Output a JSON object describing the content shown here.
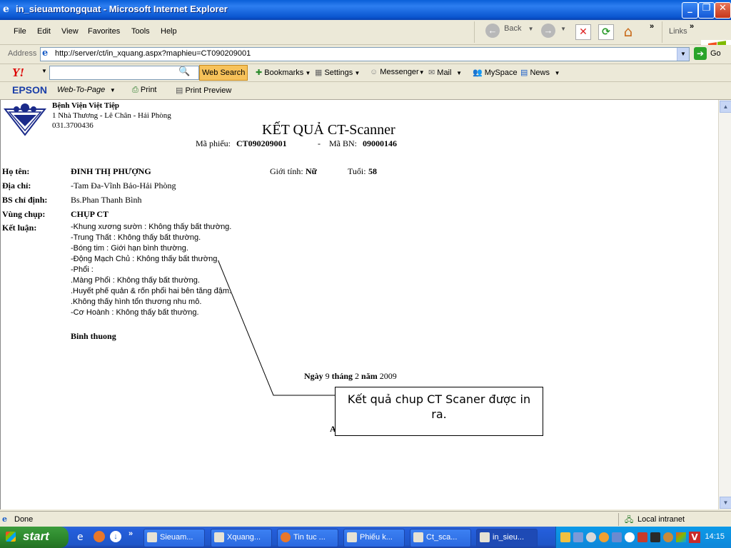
{
  "window": {
    "title": "in_sieuamtongquat - Microsoft Internet Explorer"
  },
  "menu": [
    "File",
    "Edit",
    "View",
    "Favorites",
    "Tools",
    "Help"
  ],
  "toolbar": {
    "back": "Back",
    "links": "Links"
  },
  "address": {
    "label": "Address",
    "url": "http://server/ct/in_xquang.aspx?maphieu=CT090209001",
    "go": "Go"
  },
  "yahoo": {
    "search_button": "Web Search",
    "bookmarks": "Bookmarks",
    "settings": "Settings",
    "messenger": "Messenger",
    "mail": "Mail",
    "myspace": "MySpace",
    "news": "News"
  },
  "epson": {
    "brand": "EPSON",
    "web_to_page": "Web-To-Page",
    "print": "Print",
    "print_preview": "Print Preview"
  },
  "doc": {
    "hospital": "Bệnh Viện Việt Tiệp",
    "hospital_address": "1 Nhà Thương - Lê Chân - Hải Phòng",
    "hospital_phone": "031.3700436",
    "title": "KẾT QUẢ CT-Scanner",
    "ma_phieu_label": "Mã phiếu:",
    "ma_phieu": "CT090209001",
    "separator": "-",
    "ma_bn_label": "Mã BN:",
    "ma_bn": "09000146",
    "ho_ten_label": "Họ tên:",
    "ho_ten": "ĐINH THỊ PHƯỢNG",
    "gioi_tinh_label": "Giới tính:",
    "gioi_tinh": "Nữ",
    "tuoi_label": "Tuổi:",
    "tuoi": "58",
    "dia_chi_label": "Địa chỉ:",
    "dia_chi": "-Tam Đa-Vĩnh Bảo-Hải Phòng",
    "bs_label": "BS chỉ định:",
    "bs": "Bs.Phan Thanh Bình",
    "vung_chup_label": "Vùng chụp:",
    "vung_chup": "CHỤP CT",
    "ket_luan_label": "Kết luận:",
    "ket_luan_lines": [
      "-Khung xương sườn : Không thấy bất thường.",
      "-Trung Thất : Không thấy bất thường.",
      "-Bóng tim : Giới hạn bình thường.",
      "-Động Mạch Chủ : Không thấy bất thường.",
      "-Phổi :",
      ".Màng Phổi : Không thấy bất thường.",
      ".Huyết phế quản & rốn phổi hai bên tăng đậm.",
      ".Không thấy hình tổn thương nhu mô.",
      "-Cơ Hoành : Không thấy bất thường."
    ],
    "summary": "Binh thuong",
    "date_ngay_label": "Ngày",
    "date_day": "9",
    "date_thang_label": "tháng",
    "date_month": "2",
    "date_nam_label": "năm",
    "date_year": "2009",
    "partial_letter": "A"
  },
  "callout": {
    "text": "Kết quả chup CT Scaner được in ra."
  },
  "status": {
    "left": "Done",
    "zone": "Local intranet"
  },
  "taskbar": {
    "start": "start",
    "tasks": [
      "Sieuam...",
      "Xquang...",
      "Tin tuc ...",
      "Phiếu k...",
      "Ct_sca...",
      "in_sieu..."
    ],
    "clock": "14:15"
  }
}
